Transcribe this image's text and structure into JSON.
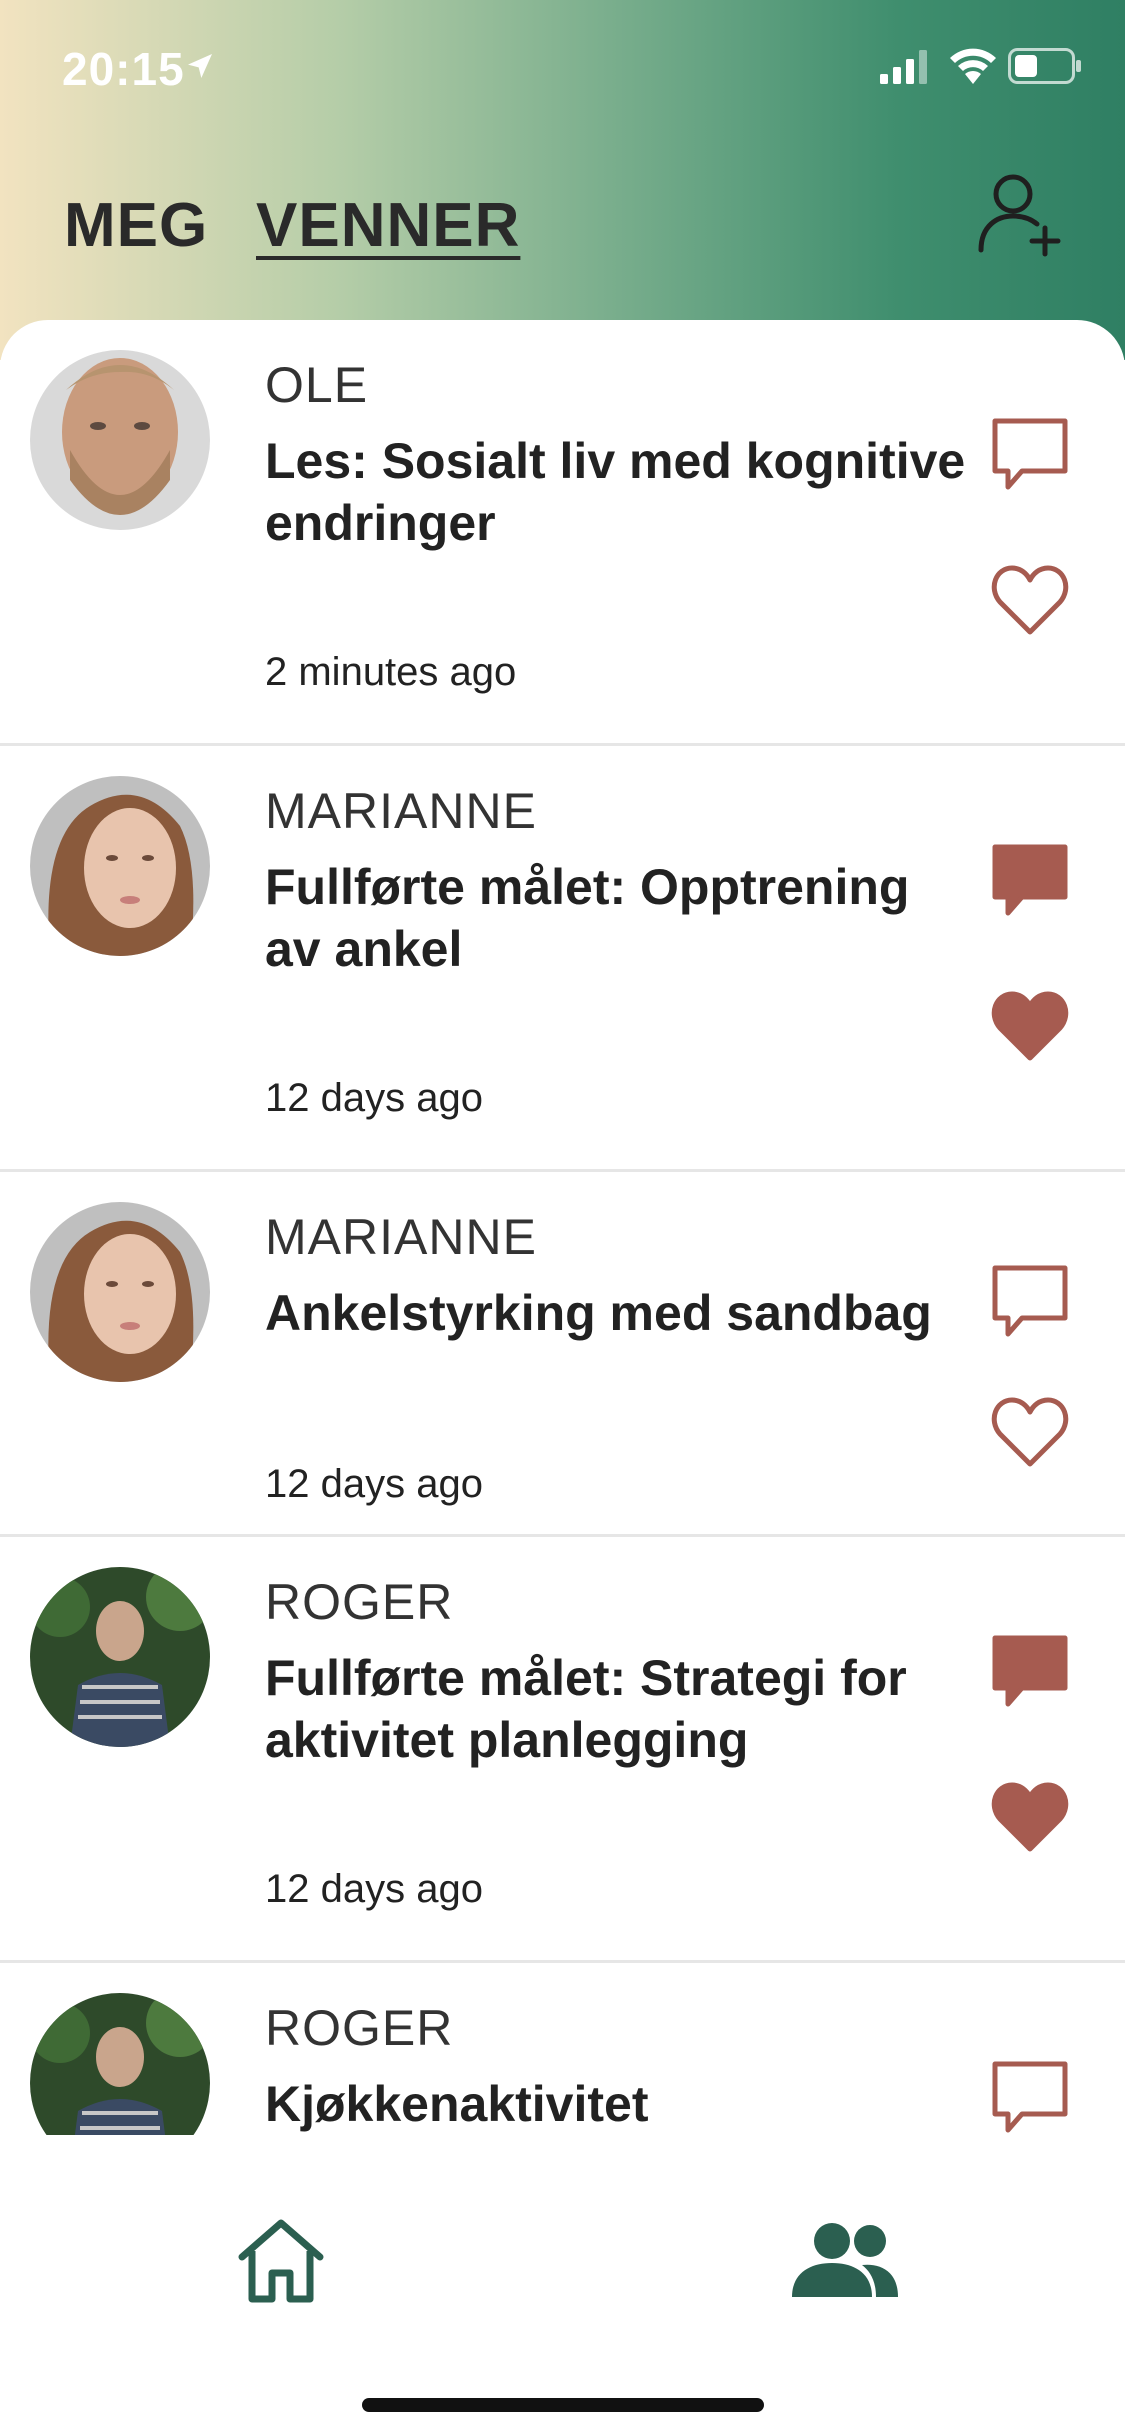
{
  "status_bar": {
    "time": "20:15",
    "location_icon": "location-arrow-icon",
    "signal_icon": "cellular-signal-icon",
    "wifi_icon": "wifi-icon",
    "battery_icon": "battery-icon"
  },
  "header": {
    "tabs": [
      {
        "label": "MEG",
        "active": false
      },
      {
        "label": "VENNER",
        "active": true
      }
    ],
    "add_friend_icon": "add-person-icon"
  },
  "feed": [
    {
      "name": "OLE",
      "title": "Les: Sosialt liv med kognitive endringer",
      "time": "2 minutes ago",
      "commented": false,
      "liked": false,
      "avatar": "bearded-man"
    },
    {
      "name": "MARIANNE",
      "title": "Fullførte målet: Opptrening av ankel",
      "time": "12 days ago",
      "commented": true,
      "liked": true,
      "avatar": "young-woman"
    },
    {
      "name": "MARIANNE",
      "title": "Ankelstyrking med sandbag",
      "time": "12 days ago",
      "commented": false,
      "liked": false,
      "avatar": "young-woman"
    },
    {
      "name": "ROGER",
      "title": "Fullførte målet: Strategi for aktivitet planlegging",
      "time": "12 days ago",
      "commented": true,
      "liked": true,
      "avatar": "older-man"
    },
    {
      "name": "ROGER",
      "title": "Kjøkkenaktivitet",
      "time": "",
      "commented": false,
      "liked": false,
      "avatar": "older-man"
    }
  ],
  "bottom_nav": {
    "items": [
      {
        "icon": "home-icon",
        "active": false
      },
      {
        "icon": "friends-icon",
        "active": true
      }
    ]
  },
  "colors": {
    "accent": "#a65b50",
    "nav": "#2b5f50",
    "header_start": "#f2e3c0",
    "header_end": "#2f7f63"
  }
}
